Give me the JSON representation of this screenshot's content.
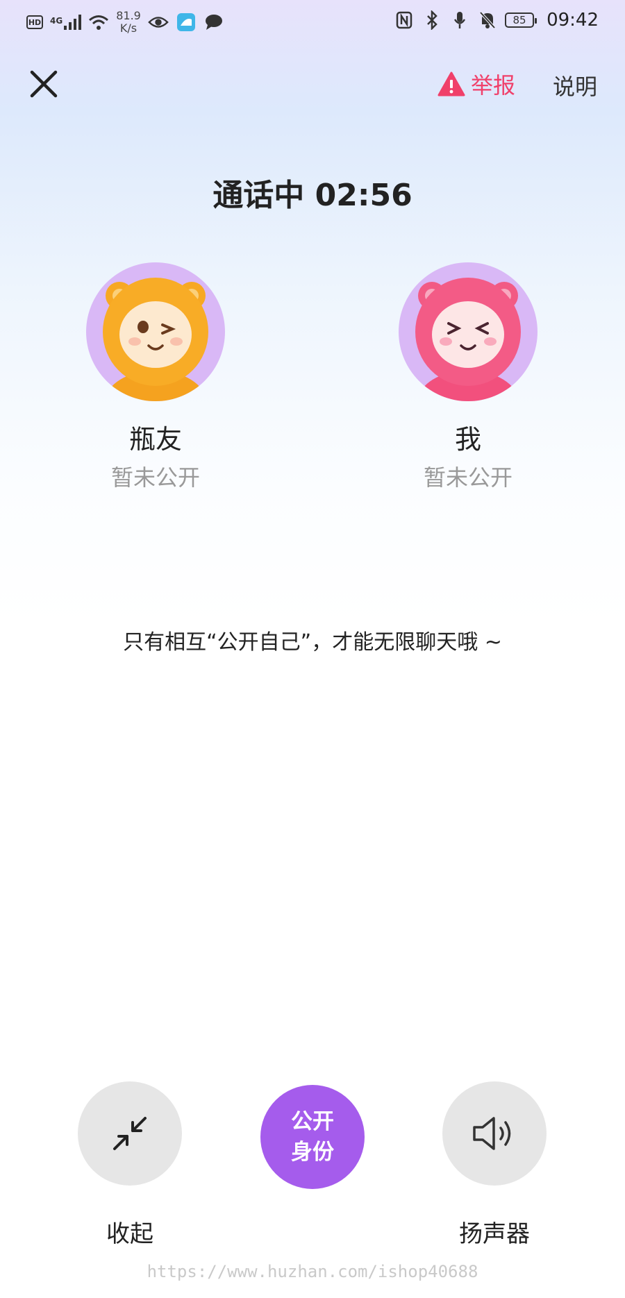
{
  "status_bar": {
    "hd": "HD",
    "network": "4G",
    "speed_value": "81.9",
    "speed_unit": "K/s",
    "battery": "85",
    "time": "09:42"
  },
  "header": {
    "report_label": "举报",
    "help_label": "说明"
  },
  "call": {
    "status": "通话中 02:56"
  },
  "participants": [
    {
      "name": "瓶友",
      "status": "暂未公开"
    },
    {
      "name": "我",
      "status": "暂未公开"
    }
  ],
  "hint": "只有相互“公开自己”，才能无限聊天哦 ~",
  "controls": {
    "minimize_label": "收起",
    "reveal_line1": "公开",
    "reveal_line2": "身份",
    "speaker_label": "扬声器"
  },
  "watermark": "https://www.huzhan.com/ishop40688",
  "colors": {
    "accent_purple": "#a55cec",
    "report_red": "#f0406a",
    "avatar_bg": "#d9b8f6"
  }
}
